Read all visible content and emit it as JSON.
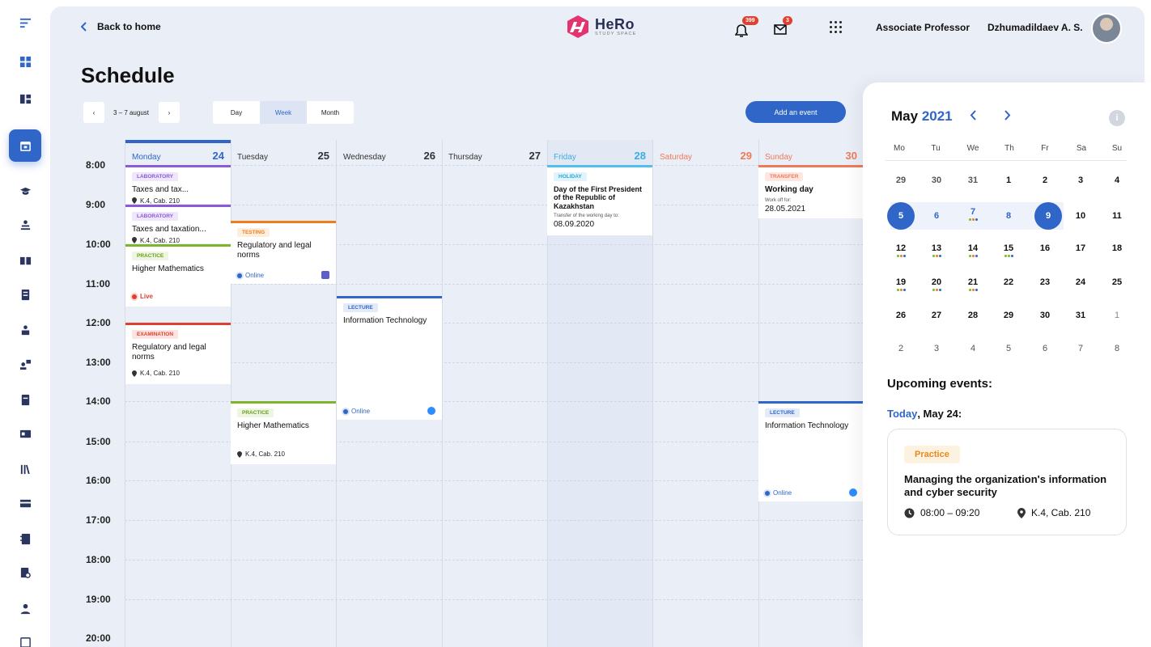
{
  "header": {
    "back_label": "Back to home",
    "logo_name": "HeRo",
    "logo_sub": "STUDY SPACE",
    "notifications_count": "399",
    "messages_count": "3",
    "role": "Associate Professor",
    "user_name": "Dzhumadildaev A. S."
  },
  "page": {
    "title": "Schedule"
  },
  "toolbar": {
    "range": "3 – 7 august",
    "prev": "‹",
    "next": "›",
    "views": [
      "Day",
      "Week",
      "Month"
    ],
    "active_view": "Week",
    "add_event": "Add an event"
  },
  "hours": [
    "8:00",
    "9:00",
    "10:00",
    "11:00",
    "12:00",
    "13:00",
    "14:00",
    "15:00",
    "16:00",
    "17:00",
    "18:00",
    "19:00",
    "20:00"
  ],
  "days": [
    {
      "name": "Monday",
      "date": "24",
      "color": "#2f66c8"
    },
    {
      "name": "Tuesday",
      "date": "25",
      "color": "#333333"
    },
    {
      "name": "Wednesday",
      "date": "26",
      "color": "#333333"
    },
    {
      "name": "Thursday",
      "date": "27",
      "color": "#333333"
    },
    {
      "name": "Friday",
      "date": "28",
      "color": "#3aaee0"
    },
    {
      "name": "Saturday",
      "date": "29",
      "color": "#ef7a5a"
    },
    {
      "name": "Sunday",
      "date": "30",
      "color": "#ef7a5a"
    }
  ],
  "events": {
    "mon1": {
      "tag": "Laboratory",
      "title": "Taxes and tax...",
      "location": "K.4, Cab. 210"
    },
    "mon2": {
      "tag": "Laboratory",
      "title": "Taxes and taxation...",
      "location": "K.4, Cab. 210"
    },
    "mon3": {
      "tag": "Practice",
      "title": "Higher Mathematics",
      "status": "Live"
    },
    "mon4": {
      "tag": "Examination",
      "title": "Regulatory and legal norms",
      "location": "K.4, Cab. 210"
    },
    "tue1": {
      "tag": "Testing",
      "title": "Regulatory and legal norms",
      "mode": "Online"
    },
    "tue2": {
      "tag": "Practice",
      "title": "Higher Mathematics",
      "location": "K.4, Cab. 210"
    },
    "wed1": {
      "tag": "Lecture",
      "title": "Information Technology",
      "mode": "Online"
    },
    "fri1": {
      "tag": "Holiday",
      "title": "Day of the First President of the Republic of Kazakhstan",
      "sub": "Transfer of the working day to:",
      "value": "08.09.2020"
    },
    "sun1": {
      "tag": "Transfer",
      "title": "Working day",
      "sub": "Work off for:",
      "value": "28.05.2021"
    },
    "sun2": {
      "tag": "Lecture",
      "title": "Information Technology",
      "mode": "Online"
    }
  },
  "mini_calendar": {
    "month": "May",
    "year": "2021",
    "weekdays": [
      "Mo",
      "Tu",
      "We",
      "Th",
      "Fr",
      "Sa",
      "Su"
    ],
    "weeks": [
      [
        "29",
        "30",
        "31",
        "1",
        "2",
        "3",
        "4"
      ],
      [
        "5",
        "6",
        "7",
        "8",
        "9",
        "10",
        "11"
      ],
      [
        "12",
        "13",
        "14",
        "15",
        "16",
        "17",
        "18"
      ],
      [
        "19",
        "20",
        "21",
        "22",
        "23",
        "24",
        "25"
      ],
      [
        "26",
        "27",
        "28",
        "29",
        "30",
        "31",
        "1"
      ],
      [
        "2",
        "3",
        "4",
        "5",
        "6",
        "7",
        "8"
      ]
    ]
  },
  "upcoming": {
    "title": "Upcoming events:",
    "today_label": "Today",
    "date": ", May 24:",
    "card": {
      "badge": "Practice",
      "title": "Managing the organization's information and cyber security",
      "time": "08:00 – 09:20",
      "location": "K.4, Cab. 210"
    }
  },
  "colors": {
    "accent": "#2f66c8",
    "laboratory": "#8a5bd6",
    "practice": "#7fb52a",
    "examination": "#e0402f",
    "testing": "#ef7d1a",
    "lecture": "#2f66c8",
    "holiday": "#4fc0ee",
    "transfer": "#ef7a5a"
  }
}
